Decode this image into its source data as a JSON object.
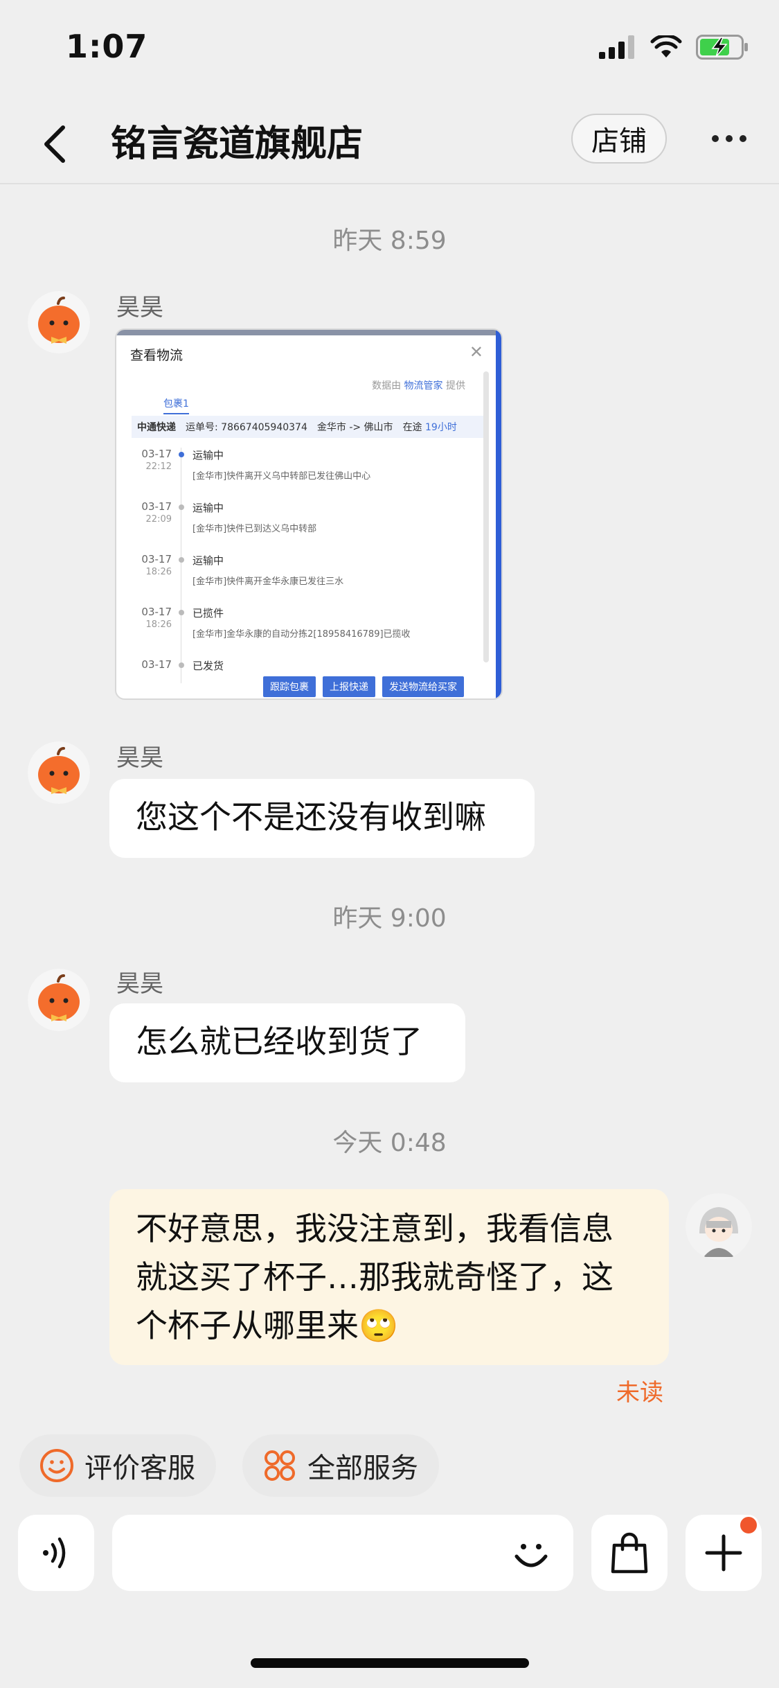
{
  "status_bar": {
    "time": "1:07"
  },
  "nav": {
    "title": "铭言瓷道旗舰店",
    "shop_button": "店铺"
  },
  "messages": [
    {
      "timestamp": "昨天 8:59",
      "sender": "昊昊",
      "type": "image"
    },
    {
      "sender": "昊昊",
      "text": "您这个不是还没有收到嘛"
    },
    {
      "timestamp": "昨天 9:00",
      "sender": "昊昊",
      "text": "怎么就已经收到货了"
    },
    {
      "timestamp": "今天 0:48",
      "sender": "self",
      "text_lines": [
        "不好意思，我没注意到，我看信息",
        "就这买了杯子…那我就奇怪了，这",
        "个杯子从哪里来🙄"
      ],
      "status": "未读"
    }
  ],
  "logistics_screenshot": {
    "title": "查看物流",
    "source_prefix": "数据由",
    "source_name": "物流管家",
    "source_suffix": "提供",
    "tab": "包裹1",
    "carrier": "中通快递",
    "tracking_label": "运单号: 78667405940374",
    "route": "金华市 -> 佛山市",
    "transit_label": "在途",
    "transit_time": "19小时",
    "events": [
      {
        "date": "03-17",
        "time": "22:12",
        "status": "运输中",
        "detail": "[金华市]快件离开义乌中转部已发往佛山中心"
      },
      {
        "date": "03-17",
        "time": "22:09",
        "status": "运输中",
        "detail": "[金华市]快件已到达义乌中转部"
      },
      {
        "date": "03-17",
        "time": "18:26",
        "status": "运输中",
        "detail": "[金华市]快件离开金华永康已发往三水"
      },
      {
        "date": "03-17",
        "time": "18:26",
        "status": "已揽件",
        "detail": "[金华市]金华永康的自动分拣2[18958416789]已揽收"
      },
      {
        "date": "03-17",
        "time": "",
        "status": "已发货",
        "detail": ""
      }
    ],
    "buttons": [
      "跟踪包裹",
      "上报快递",
      "发送物流给买家"
    ]
  },
  "quick_actions": {
    "rate": "评价客服",
    "all_services": "全部服务"
  },
  "colors": {
    "accent": "#ef6a2a",
    "self_bubble": "#fdf5e3",
    "background": "#efefef"
  }
}
